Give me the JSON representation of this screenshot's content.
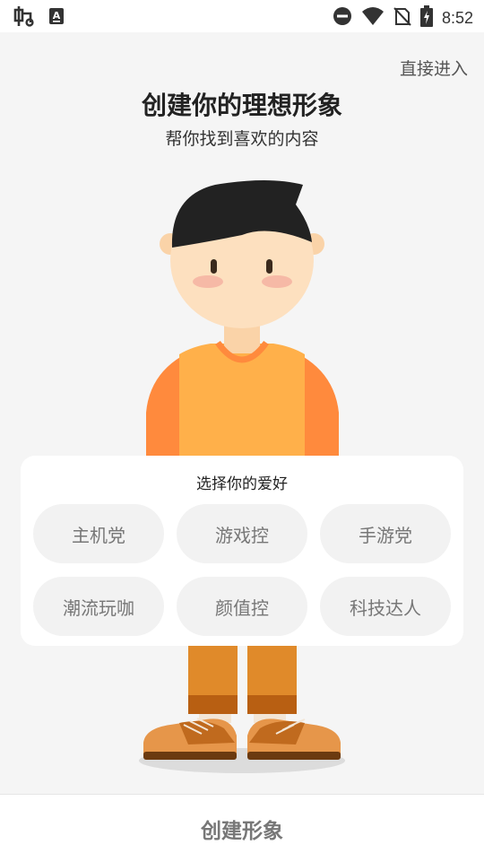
{
  "status_bar": {
    "time": "8:52",
    "left_icons": [
      "app-bug-icon",
      "keyboard-a-icon"
    ],
    "right_icons": [
      "do-not-disturb-icon",
      "wifi-icon",
      "no-sim-icon",
      "battery-charging-icon"
    ]
  },
  "header": {
    "skip_label": "直接进入",
    "title": "创建你的理想形象",
    "subtitle": "帮你找到喜欢的内容"
  },
  "hobbies": {
    "title": "选择你的爱好",
    "options": [
      "主机党",
      "游戏控",
      "手游党",
      "潮流玩咖",
      "颜值控",
      "科技达人"
    ]
  },
  "footer": {
    "create_label": "创建形象"
  },
  "colors": {
    "background": "#f5f5f5",
    "shirt": "#ffb04a",
    "sleeve": "#ff8a3d",
    "pants": "#e08a2a",
    "skin": "#fde0bf",
    "hair": "#222222"
  }
}
